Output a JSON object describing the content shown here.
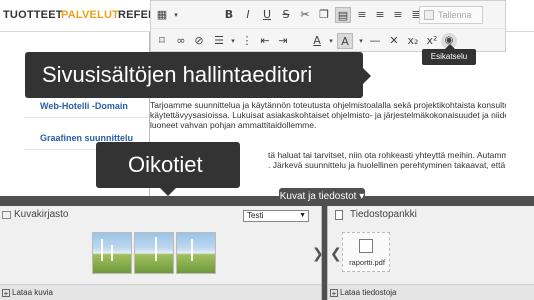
{
  "nav": {
    "items": [
      "TUOTTEET",
      "PALVELUT",
      "REFEREN"
    ]
  },
  "sidebar": {
    "links": [
      "Web-Hotelli -Domain",
      "Graafinen suunnittelu"
    ]
  },
  "content": {
    "paragraph1_line1": "Tarjoamme suunnittelua ja käytännön toteutusta ohjelmistoalalla sekä projektikohtaista konsultointia ja analysointia",
    "paragraph1_line2": "käytettävyysasioissa. Lukuisat asiakaskohtaiset ohjelmisto- ja järjestelmäkokonaisuudet ja niiden toteutukset ovat",
    "paragraph1_line3": "luoneet vahvan pohjan ammattitaidollemme.",
    "paragraph2_line1": "tä haluat tai tarvitset, niin ota rohkeasti yhteyttä meihin. Autamme mielellämme sinua",
    "paragraph2_line2": ". Järkevä suunnittelu ja huolellinen perehtyminen takaavat, että asiakkaanamme saat juuri"
  },
  "toolbar": {
    "save_label": "Tallenna",
    "row1_icons": [
      "table-icon",
      "bold-icon",
      "italic-icon",
      "underline-icon",
      "strikethrough-icon",
      "cut-icon",
      "copy-icon",
      "paste-icon",
      "align-left-icon",
      "align-center-icon",
      "align-right-icon",
      "justify-icon"
    ],
    "row2_icons": [
      "bookmark-icon",
      "link-icon",
      "unlink-icon",
      "bullet-list-icon",
      "numbered-list-icon",
      "outdent-icon",
      "indent-icon",
      "font-color-icon",
      "highlight-icon",
      "horizontal-rule-icon",
      "clear-format-icon",
      "subscript-icon",
      "superscript-icon",
      "code-icon",
      "preview-icon"
    ]
  },
  "callouts": {
    "editor": "Sivusisältöjen hallintaeditori",
    "shortcuts": "Oikotiet",
    "preview": "Esikatselu"
  },
  "media_tab": {
    "label": "Kuvat ja tiedostot",
    "arrow": "▾"
  },
  "image_library": {
    "title": "Kuvakirjasto",
    "folder_selected": "Testi",
    "footer": "Lataa kuvia",
    "thumbnails": 3
  },
  "file_bank": {
    "title": "Tiedostopankki",
    "file_name": "raportti.pdf",
    "footer": "Lataa tiedostoja"
  },
  "colors": {
    "accent": "#e8a21d",
    "link": "#2a5ea8",
    "dark": "#333333",
    "bar": "#4f4f4f"
  }
}
